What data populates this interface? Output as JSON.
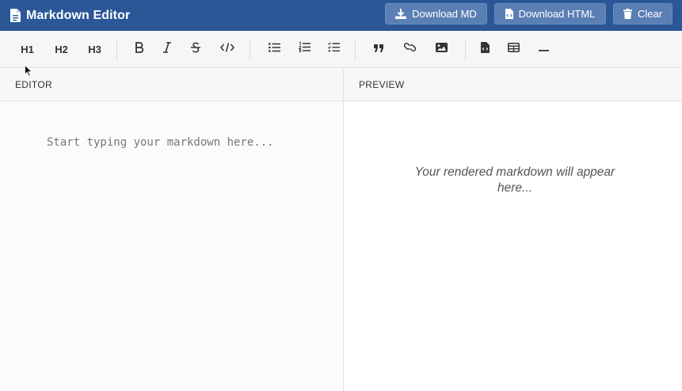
{
  "header": {
    "title": "Markdown Editor",
    "brand_icon": "document-icon",
    "actions": [
      {
        "label": "Download MD",
        "icon": "download-icon"
      },
      {
        "label": "Download HTML",
        "icon": "file-code-icon"
      },
      {
        "label": "Clear",
        "icon": "trash-icon"
      }
    ]
  },
  "toolbar": {
    "h1": "H1",
    "h2": "H2",
    "h3": "H3",
    "tools": [
      "bold-icon",
      "italic-icon",
      "strikethrough-icon",
      "code-icon",
      "bullet-list-icon",
      "numbered-list-icon",
      "task-list-icon",
      "quote-icon",
      "link-icon",
      "image-icon",
      "file-code-icon",
      "table-icon",
      "horizontal-rule-icon"
    ]
  },
  "editor": {
    "label": "EDITOR",
    "placeholder": "Start typing your markdown here..."
  },
  "preview": {
    "label": "PREVIEW",
    "placeholder": "Your rendered markdown will appear here..."
  },
  "colors": {
    "header_bg": "#2b5797",
    "header_button_bg": "#5a7fb4",
    "toolbar_bg": "#f6f6f6"
  }
}
